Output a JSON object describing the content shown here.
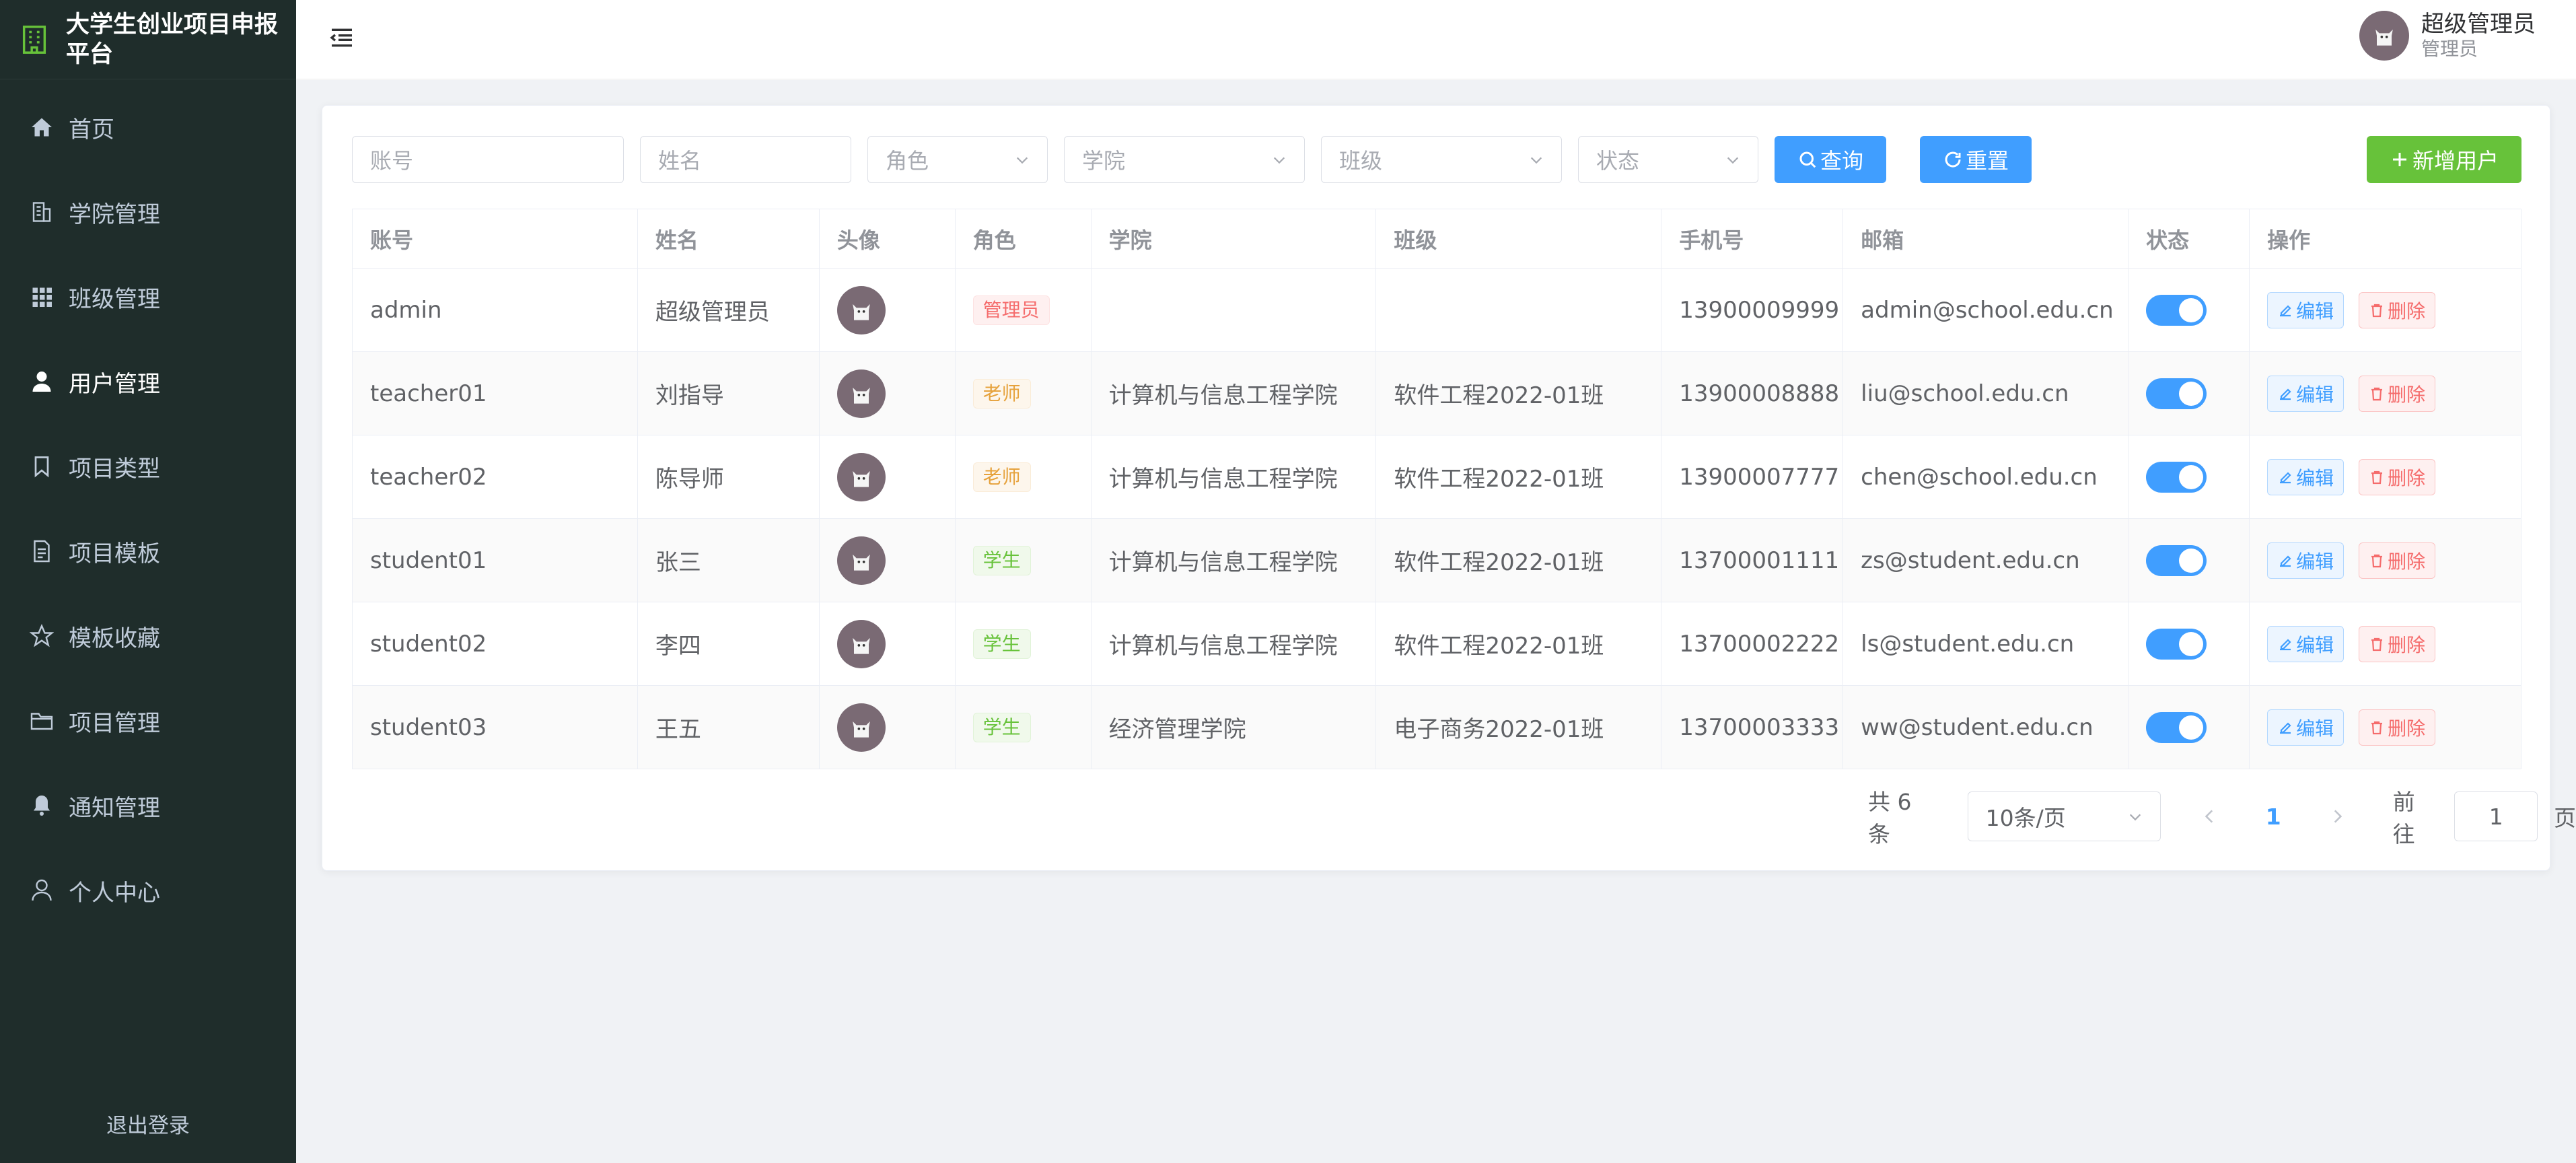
{
  "brand": {
    "title": "大学生创业项目申报平台"
  },
  "sidebar": {
    "items": [
      {
        "label": "首页",
        "icon": "home-icon",
        "active": false
      },
      {
        "label": "学院管理",
        "icon": "building-icon",
        "active": false
      },
      {
        "label": "班级管理",
        "icon": "grid-icon",
        "active": false
      },
      {
        "label": "用户管理",
        "icon": "user-icon",
        "active": true
      },
      {
        "label": "项目类型",
        "icon": "bookmark-icon",
        "active": false
      },
      {
        "label": "项目模板",
        "icon": "document-icon",
        "active": false
      },
      {
        "label": "模板收藏",
        "icon": "star-icon",
        "active": false
      },
      {
        "label": "项目管理",
        "icon": "folder-icon",
        "active": false
      },
      {
        "label": "通知管理",
        "icon": "bell-icon",
        "active": false
      },
      {
        "label": "个人中心",
        "icon": "user-outline-icon",
        "active": false
      }
    ],
    "logout": "退出登录"
  },
  "header": {
    "user_name": "超级管理员",
    "user_role": "管理员"
  },
  "filters": {
    "account_placeholder": "账号",
    "name_placeholder": "姓名",
    "role_placeholder": "角色",
    "college_placeholder": "学院",
    "class_placeholder": "班级",
    "status_placeholder": "状态",
    "query_label": "查询",
    "reset_label": "重置",
    "add_label": "新增用户"
  },
  "table": {
    "columns": [
      "账号",
      "姓名",
      "头像",
      "角色",
      "学院",
      "班级",
      "手机号",
      "邮箱",
      "状态",
      "操作"
    ],
    "edit_label": "编辑",
    "delete_label": "删除",
    "rows": [
      {
        "account": "admin",
        "name": "超级管理员",
        "role": "管理员",
        "role_type": "admin",
        "college": "",
        "class": "",
        "phone": "13900009999",
        "email": "admin@school.edu.cn",
        "enabled": true
      },
      {
        "account": "teacher01",
        "name": "刘指导",
        "role": "老师",
        "role_type": "teacher",
        "college": "计算机与信息工程学院",
        "class": "软件工程2022-01班",
        "phone": "13900008888",
        "email": "liu@school.edu.cn",
        "enabled": true
      },
      {
        "account": "teacher02",
        "name": "陈导师",
        "role": "老师",
        "role_type": "teacher",
        "college": "计算机与信息工程学院",
        "class": "软件工程2022-01班",
        "phone": "13900007777",
        "email": "chen@school.edu.cn",
        "enabled": true
      },
      {
        "account": "student01",
        "name": "张三",
        "role": "学生",
        "role_type": "student",
        "college": "计算机与信息工程学院",
        "class": "软件工程2022-01班",
        "phone": "13700001111",
        "email": "zs@student.edu.cn",
        "enabled": true
      },
      {
        "account": "student02",
        "name": "李四",
        "role": "学生",
        "role_type": "student",
        "college": "计算机与信息工程学院",
        "class": "软件工程2022-01班",
        "phone": "13700002222",
        "email": "ls@student.edu.cn",
        "enabled": true
      },
      {
        "account": "student03",
        "name": "王五",
        "role": "学生",
        "role_type": "student",
        "college": "经济管理学院",
        "class": "电子商务2022-01班",
        "phone": "13700003333",
        "email": "ww@student.edu.cn",
        "enabled": true
      }
    ]
  },
  "pagination": {
    "total_text": "共 6 条",
    "page_size": "10条/页",
    "current_page": "1",
    "goto_label": "前往",
    "goto_value": "1",
    "page_suffix": "页"
  },
  "colors": {
    "sidebar_bg": "#1f2d2b",
    "primary": "#409eff",
    "success": "#67c23a",
    "danger": "#f56c6c",
    "warning": "#e6a23c"
  }
}
